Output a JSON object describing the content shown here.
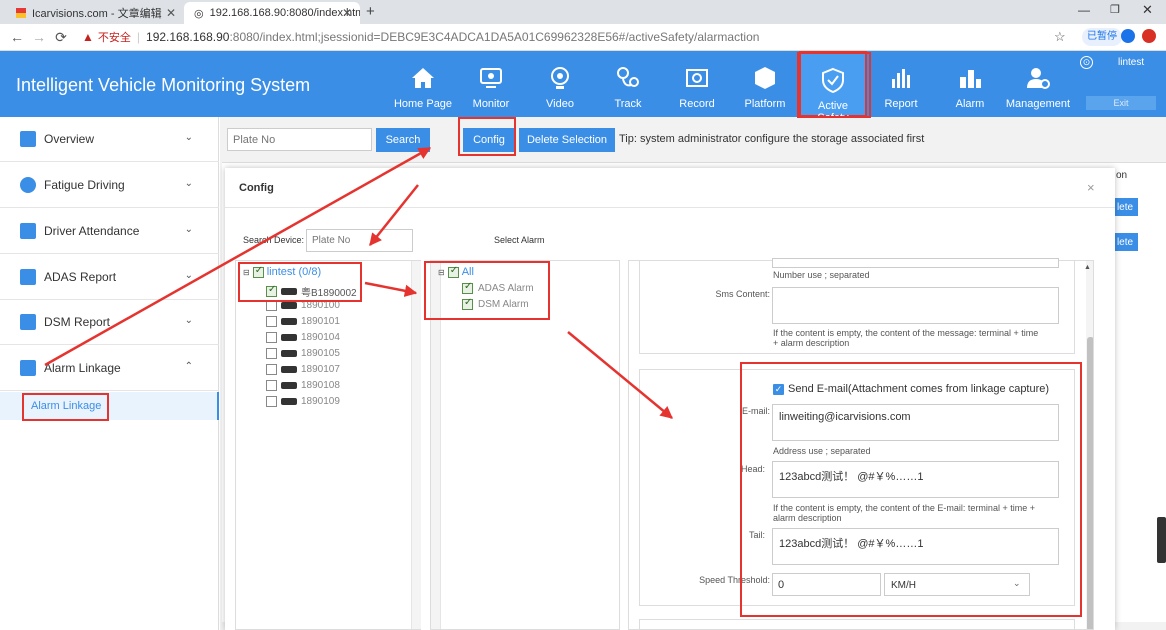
{
  "browser": {
    "tabs": [
      {
        "title": "Icarvisions.com - 文章编辑"
      },
      {
        "title": "192.168.168.90:8080/index.htm"
      }
    ],
    "new_tab": "+",
    "security_label": "不安全",
    "url_host": "192.168.168.90",
    "url_rest": ":8080/index.html;jsessionid=DEBC9E3C4ADCA1DA5A01C69962328E56#/activeSafety/alarmaction",
    "paused_label": "已暂停"
  },
  "app": {
    "title": "Intelligent Vehicle Monitoring System",
    "nav": [
      {
        "label": "Home Page",
        "icon": "home-icon"
      },
      {
        "label": "Monitor",
        "icon": "monitor-icon"
      },
      {
        "label": "Video",
        "icon": "camera-icon"
      },
      {
        "label": "Track",
        "icon": "track-icon"
      },
      {
        "label": "Record",
        "icon": "film-icon"
      },
      {
        "label": "Platform",
        "icon": "cube-icon"
      },
      {
        "label": "Active Safety",
        "icon": "shield-icon"
      },
      {
        "label": "Report",
        "icon": "bar-chart-icon"
      },
      {
        "label": "Alarm",
        "icon": "alarm-icon"
      },
      {
        "label": "Management",
        "icon": "user-gear-icon"
      }
    ],
    "user": "lintest",
    "exit": "Exit"
  },
  "sidebar": {
    "items": [
      {
        "label": "Overview"
      },
      {
        "label": "Fatigue Driving"
      },
      {
        "label": "Driver Attendance"
      },
      {
        "label": "ADAS Report"
      },
      {
        "label": "DSM Report"
      },
      {
        "label": "Alarm Linkage"
      }
    ],
    "sub_item": "Alarm Linkage"
  },
  "toolbar": {
    "plate_placeholder": "Plate No",
    "search": "Search",
    "config": "Config",
    "delete_selection": "Delete Selection",
    "tip": "Tip: system administrator configure the storage associated first"
  },
  "background_table": {
    "header_fragment": "on",
    "delete_label": "Delete",
    "delete_fragment": "lete"
  },
  "modal": {
    "title": "Config",
    "close": "×",
    "search_device_label": "Search Device:",
    "search_device_placeholder": "Plate No",
    "select_alarm_label": "Select Alarm",
    "tree_root": "lintest (0/8)",
    "devices": [
      "粤B1890002",
      "1890100",
      "1890101",
      "1890104",
      "1890105",
      "1890107",
      "1890108",
      "1890109"
    ],
    "alarm_root": "All",
    "alarms": [
      "ADAS Alarm",
      "DSM Alarm"
    ],
    "number_help": "Number use ; separated",
    "sms_label": "Sms Content:",
    "sms_help": "If the content is empty, the content of the message: terminal + time + alarm description",
    "email_checkbox": "Send E-mail(Attachment comes from linkage capture)",
    "email_label": "E-mail:",
    "email_value": "linweiting@icarvisions.com",
    "address_help": "Address use ; separated",
    "head_label": "Head:",
    "head_value": "123abcd测试！ @#￥%……1",
    "head_help": "If the content is empty, the content of the E-mail: terminal + time + alarm description",
    "tail_label": "Tail:",
    "tail_value": "123abcd测试！ @#￥%……1",
    "speed_label": "Speed Threshold:",
    "speed_value": "0",
    "speed_unit": "KM/H"
  },
  "colors": {
    "header": "#3b8ee6",
    "annotation": "#e5342f"
  }
}
